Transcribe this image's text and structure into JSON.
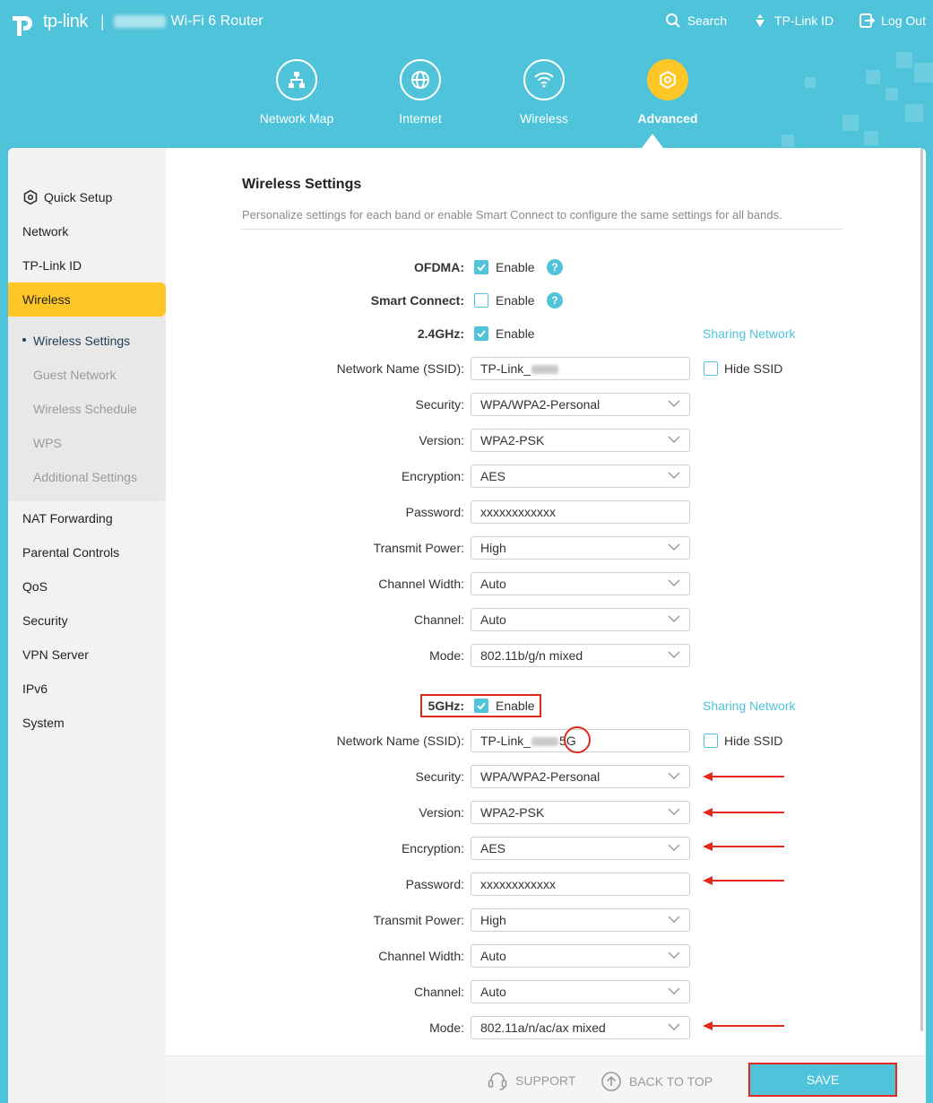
{
  "header": {
    "logo_text": "tp-link",
    "separator": "|",
    "router_name": "Wi-Fi 6 Router",
    "links": [
      {
        "icon": "search-icon",
        "label": "Search"
      },
      {
        "icon": "tplink-id-icon",
        "label": "TP-Link ID"
      },
      {
        "icon": "logout-icon",
        "label": "Log Out"
      }
    ],
    "nav": [
      {
        "icon": "network-map-icon",
        "label": "Network Map"
      },
      {
        "icon": "globe-icon",
        "label": "Internet"
      },
      {
        "icon": "wifi-icon",
        "label": "Wireless"
      },
      {
        "icon": "gear-icon",
        "label": "Advanced",
        "active": true
      }
    ]
  },
  "sidebar": {
    "items": [
      "Quick Setup",
      "Network",
      "TP-Link ID",
      "Wireless",
      "NAT Forwarding",
      "Parental Controls",
      "QoS",
      "Security",
      "VPN Server",
      "IPv6",
      "System"
    ],
    "active": "Wireless",
    "sub_items": [
      "Wireless Settings",
      "Guest Network",
      "Wireless Schedule",
      "WPS",
      "Additional Settings"
    ],
    "current_sub": "Wireless Settings"
  },
  "main": {
    "title": "Wireless Settings",
    "subtitle": "Personalize settings for each band or enable Smart Connect to configure the same settings for all bands.",
    "ofdma_label": "OFDMA:",
    "smart_connect_label": "Smart Connect:",
    "enable_label": "Enable",
    "help_glyph": "?",
    "sharing_network": "Sharing Network",
    "hide_ssid": "Hide SSID",
    "labels": {
      "ssid": "Network Name (SSID):",
      "security": "Security:",
      "version": "Version:",
      "encryption": "Encryption:",
      "password": "Password:",
      "transmit_power": "Transmit Power:",
      "channel_width": "Channel Width:",
      "channel": "Channel:",
      "mode": "Mode:"
    },
    "band24": {
      "label": "2.4GHz:",
      "ssid_prefix": "TP-Link_",
      "security": "WPA/WPA2-Personal",
      "version": "WPA2-PSK",
      "encryption": "AES",
      "password": "xxxxxxxxxxxx",
      "transmit_power": "High",
      "channel_width": "Auto",
      "channel": "Auto",
      "mode": "802.11b/g/n mixed"
    },
    "band5": {
      "label": "5GHz:",
      "ssid_prefix": "TP-Link_",
      "ssid_suffix": "5G",
      "security": "WPA/WPA2-Personal",
      "version": "WPA2-PSK",
      "encryption": "AES",
      "password": "xxxxxxxxxxxx",
      "transmit_power": "High",
      "channel_width": "Auto",
      "channel": "Auto",
      "mode": "802.11a/n/ac/ax mixed"
    }
  },
  "footer": {
    "support": "SUPPORT",
    "back_to_top": "BACK TO TOP",
    "save": "SAVE"
  },
  "colors": {
    "brand": "#4ec3d9",
    "active": "#ffc628",
    "annotation": "#e0281c"
  }
}
